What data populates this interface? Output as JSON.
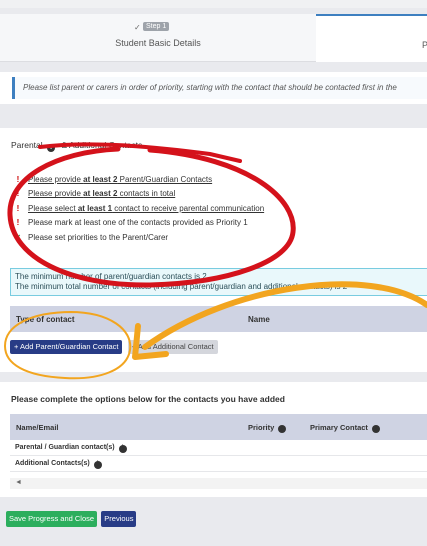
{
  "stepper": {
    "step1": {
      "badge": "Step 1",
      "title": "Student Basic Details",
      "check": "✓"
    },
    "step2": {
      "title": "P"
    }
  },
  "info_text": "Please list parent or carers in order of priority, starting with the contact that should be contacted first in the",
  "contacts": {
    "title_parental": "Parental",
    "title_rest": "& Additional Contacts",
    "requirements": [
      {
        "icon": "!",
        "status": "error",
        "parts": [
          "Please provide ",
          "at least 2",
          " Parent/Guardian Contacts"
        ],
        "link": true
      },
      {
        "icon": "!",
        "status": "error",
        "parts": [
          "Please provide ",
          "at least 2",
          " contacts in total"
        ],
        "link": true
      },
      {
        "icon": "!",
        "status": "error",
        "parts": [
          "Please select ",
          "at least 1",
          " contact to receive parental communication"
        ],
        "link": true
      },
      {
        "icon": "!",
        "status": "error",
        "parts": [
          "Please mark at least one of the contacts provided as Priority 1",
          "",
          ""
        ],
        "link": false
      },
      {
        "icon": "✓",
        "status": "ok",
        "parts": [
          "Please set priorities to the Parent/Carer",
          "",
          ""
        ],
        "link": false
      }
    ],
    "alert_line1": "The minimum number of parent/guardian contacts is 2",
    "alert_line2": "The minimum total number of contacts (including parent/guardian and additional contacts) is 2",
    "table_headers": [
      "Type of contact",
      "Name"
    ],
    "add_parent_label": "+ Add Parent/Guardian Contact",
    "add_additional_label": "+ Add Additional Contact"
  },
  "options": {
    "title": "Please complete the options below for the contacts you have added",
    "headers": [
      "Name/Email",
      "Priority",
      "Primary Contact"
    ],
    "rows": [
      "Parental / Guardian contact(s)",
      "Additional Contacts(s)"
    ],
    "scroll_left": "◄"
  },
  "footer": {
    "save_label": "Save Progress and Close",
    "previous_label": "Previous"
  },
  "colors": {
    "accent": "#3d7fc0",
    "navy": "#283c86",
    "green": "#2cae5d",
    "error": "#cc0000",
    "ok": "#2e9d3f",
    "annotation_red": "#d4121b",
    "annotation_orange": "#f2a51f"
  }
}
